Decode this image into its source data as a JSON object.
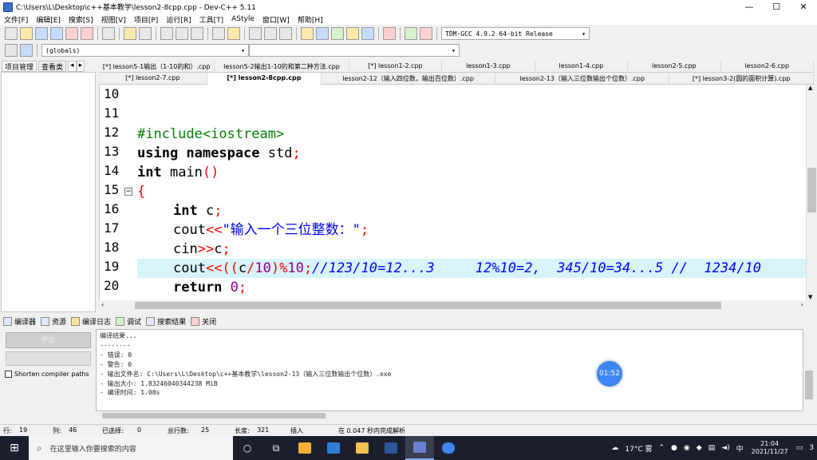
{
  "window": {
    "title": "C:\\Users\\L\\Desktop\\c++基本教学\\lesson2-8cpp.cpp - Dev-C++ 5.11",
    "minimize": "—",
    "maximize": "☐",
    "close": "✕"
  },
  "menu": [
    "文件[F]",
    "编辑[E]",
    "搜索[S]",
    "视图[V]",
    "项目[P]",
    "运行[R]",
    "工具[T]",
    "AStyle",
    "窗口[W]",
    "帮助[H]"
  ],
  "compiler_select": "TDM-GCC 4.9.2 64-bit Release",
  "scope_select": "(globals)",
  "left_tabs": {
    "project": "项目管理",
    "classes": "查看类"
  },
  "file_tabs_row1": [
    "[*] lesson5-1输出（1-10的和）.cpp",
    "lesson5-2输出1-10的和第二种方法.cpp",
    "[*] lesson1-2.cpp",
    "lesson1-3.cpp",
    "lesson1-4.cpp",
    "lesson2-5.cpp",
    "lesson2-6.cpp"
  ],
  "file_tabs_row2": [
    "[*] lesson2-7.cpp",
    "[*] lesson2-8cpp.cpp",
    "lesson2-12（输入四位数，输出百位数）.cpp",
    "lesson2-13（输入三位数输出个位数）.cpp",
    "[*] lesson3-2(圆的面积计算).cpp"
  ],
  "active_file_tab": 1,
  "code": {
    "lines": [
      "10",
      "11",
      "12",
      "13",
      "14",
      "15",
      "16",
      "17",
      "18",
      "19",
      "20"
    ],
    "l12": "#include<iostream>",
    "l13_kw": "using namespace",
    "l13_rest": " std",
    "l13_semi": ";",
    "l14_kw": "int",
    "l14_rest": " main",
    "l14_paren": "()",
    "l15": "{",
    "l16_kw": "int",
    "l16_rest": " c",
    "l16_semi": ";",
    "l17_a": "cout",
    "l17_op": "<<",
    "l17_str": "\"输入一个三位整数：\"",
    "l17_semi": ";",
    "l18_a": "cin",
    "l18_op": ">>",
    "l18_b": "c",
    "l18_semi": ";",
    "l19_a": "cout",
    "l19_op": "<<((",
    "l19_b": "c",
    "l19_op2": "/",
    "l19_n1": "10",
    "l19_op3": ")%",
    "l19_n2": "10",
    "l19_semi": ";",
    "l19_cm": "//123/10=12...3     12%10=2,  345/10=34...5 //  1234/10",
    "l20_kw": "return",
    "l20_sp": " ",
    "l20_n": "0",
    "l20_semi": ";"
  },
  "bottom_tabs": [
    "编译器",
    "资源",
    "编译日志",
    "调试",
    "搜索结果",
    "关闭"
  ],
  "abort_button": "中止",
  "shorten_paths": "Shorten compiler paths",
  "log": [
    "编译结果...",
    "--------",
    "- 错误: 0",
    "- 警告: 0",
    "- 输出文件名: C:\\Users\\L\\Desktop\\c++基本教学\\lesson2-13（输入三位数输出个位数）.exe",
    "- 输出大小: 1.83246040344238 MiB",
    "- 编译时间: 1.08s"
  ],
  "timer": "01:52",
  "status": {
    "row_label": "行:",
    "row": "19",
    "col_label": "列:",
    "col": "46",
    "sel_label": "已选择:",
    "sel": "0",
    "total_label": "总行数:",
    "total": "25",
    "len_label": "长度:",
    "len": "321",
    "mode": "插入",
    "parse": "在 0.047 秒内完成解析"
  },
  "taskbar": {
    "search_placeholder": "在这里输入你要搜索的内容",
    "weather": "17°C 雾",
    "ime": "中",
    "time": "21:04",
    "date": "2021/11/27",
    "notifications": "3"
  }
}
